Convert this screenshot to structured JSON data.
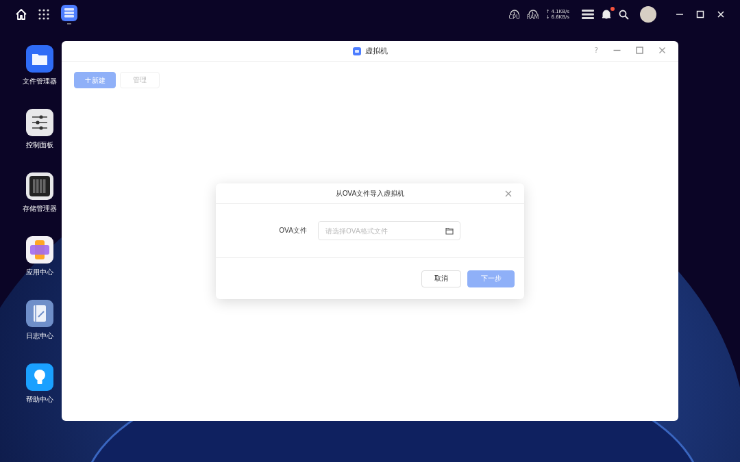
{
  "top_bar": {
    "cpu_label": "CPU",
    "ram_label": "RAM",
    "upload": "↑ 4.1KB/s",
    "download": "↓ 6.6KB/s",
    "has_notification": true
  },
  "desktop_icons": [
    {
      "kind": "folder",
      "label": "文件管理器"
    },
    {
      "kind": "sliders",
      "label": "控制面板"
    },
    {
      "kind": "storage",
      "label": "存储管理器"
    },
    {
      "kind": "apps",
      "label": "应用中心"
    },
    {
      "kind": "log",
      "label": "日志中心"
    },
    {
      "kind": "help",
      "label": "帮助中心"
    }
  ],
  "window": {
    "title": "虚拟机",
    "help": "?",
    "toolbar": [
      {
        "label": "新建",
        "icon": "+",
        "kind": "primary",
        "disabled": true
      },
      {
        "label": "管理",
        "kind": "default",
        "disabled": true
      }
    ]
  },
  "dialog": {
    "title": "从OVA文件导入虚拟机",
    "field_label": "OVA文件",
    "placeholder": "请选择OVA格式文件",
    "buttons": [
      {
        "label": "取消",
        "kind": "default",
        "disabled": false
      },
      {
        "label": "下一步",
        "kind": "primary",
        "disabled": true
      }
    ]
  }
}
